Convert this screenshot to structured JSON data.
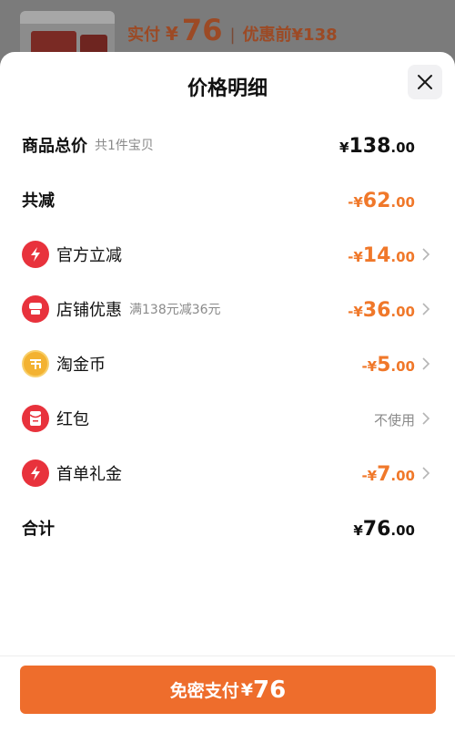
{
  "background": {
    "paid_label": "实付",
    "currency": "¥",
    "paid_amount": "76",
    "separator": "|",
    "original_label": "优惠前¥138"
  },
  "sheet": {
    "title": "价格明细"
  },
  "rows": {
    "subtotal": {
      "label": "商品总价",
      "sub": "共1件宝贝",
      "prefix": "¥",
      "int": "138",
      "dec": ".00"
    },
    "total_discount": {
      "label": "共减",
      "prefix": "-¥",
      "int": "62",
      "dec": ".00"
    },
    "official": {
      "label": "官方立减",
      "prefix": "-¥",
      "int": "14",
      "dec": ".00"
    },
    "shop": {
      "label": "店铺优惠",
      "sub": "满138元减36元",
      "prefix": "-¥",
      "int": "36",
      "dec": ".00"
    },
    "coins": {
      "label": "淘金币",
      "prefix": "-¥",
      "int": "5",
      "dec": ".00"
    },
    "redpacket": {
      "label": "红包",
      "status": "不使用"
    },
    "first_gift": {
      "label": "首单礼金",
      "prefix": "-¥",
      "int": "7",
      "dec": ".00"
    },
    "total": {
      "label": "合计",
      "prefix": "¥",
      "int": "76",
      "dec": ".00"
    }
  },
  "pay_button": {
    "label": "免密支付",
    "currency": "¥",
    "amount": "76"
  },
  "icons": {
    "official": "lightning-icon",
    "shop": "shop-icon",
    "coins": "gold-coin-icon",
    "redpacket": "red-envelope-icon",
    "first_gift": "lightning-icon"
  },
  "colors": {
    "accent": "#ee6d2c",
    "discount": "#f0782a",
    "icon_red": "#e8323c",
    "coin_gold": "#f3b231"
  }
}
